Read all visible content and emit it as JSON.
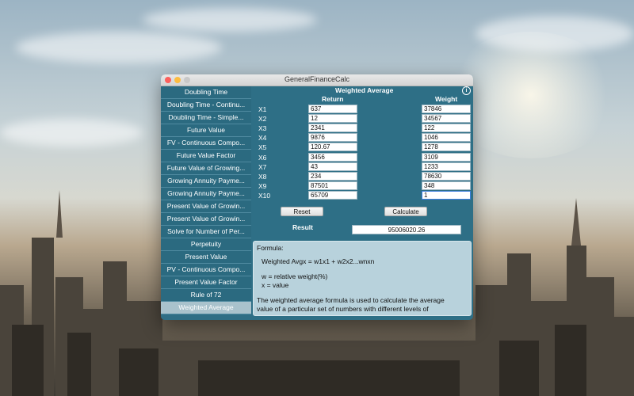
{
  "window": {
    "title": "GeneralFinanceCalc"
  },
  "sidebar": {
    "items": [
      {
        "label": "Doubling Time"
      },
      {
        "label": "Doubling Time - Continu..."
      },
      {
        "label": "Doubling Time - Simple..."
      },
      {
        "label": "Future Value"
      },
      {
        "label": "FV - Continuous Compo..."
      },
      {
        "label": "Future Value Factor"
      },
      {
        "label": "Future Value of Growing..."
      },
      {
        "label": "Growing Annuity Payme..."
      },
      {
        "label": "Growing Annuity Payme..."
      },
      {
        "label": "Present Value of Growin..."
      },
      {
        "label": "Present Value of Growin..."
      },
      {
        "label": "Solve for Number of Per..."
      },
      {
        "label": "Perpetuity"
      },
      {
        "label": "Present Value"
      },
      {
        "label": "PV - Continuous Compo..."
      },
      {
        "label": "Present Value Factor"
      },
      {
        "label": "Rule of 72"
      },
      {
        "label": "Weighted Average"
      }
    ],
    "selected": "Weighted Average"
  },
  "main": {
    "heading": "Weighted Average",
    "col_return": "Return",
    "col_weight": "Weight",
    "rows": [
      {
        "label": "X1",
        "return": "637",
        "weight": "37846"
      },
      {
        "label": "X2",
        "return": "12",
        "weight": "34567"
      },
      {
        "label": "X3",
        "return": "2341",
        "weight": "122"
      },
      {
        "label": "X4",
        "return": "9876",
        "weight": "1046"
      },
      {
        "label": "X5",
        "return": "120.67",
        "weight": "1278"
      },
      {
        "label": "X6",
        "return": "3456",
        "weight": "3109"
      },
      {
        "label": "X7",
        "return": "43",
        "weight": "1233"
      },
      {
        "label": "X8",
        "return": "234",
        "weight": "78630"
      },
      {
        "label": "X9",
        "return": "87501",
        "weight": "348"
      },
      {
        "label": "X10",
        "return": "65709",
        "weight": "1"
      }
    ],
    "reset_label": "Reset",
    "calculate_label": "Calculate",
    "result_label": "Result",
    "result_value": "95006020.26",
    "formula": {
      "title": "Formula:",
      "line1": "Weighted Avgx = w1x1 + w2x2...wnxn",
      "line2": "w = relative weight(%)",
      "line3": "x = value",
      "line4": "The weighted average formula is used to calculate the average",
      "line5": "value of a particular set of numbers with different levels of"
    }
  },
  "icons": {
    "info": "info-icon"
  },
  "colors": {
    "window_bg": "#2e6f86",
    "selected_item": "#a9c2cc",
    "formula_bg": "#b8d2dc"
  }
}
